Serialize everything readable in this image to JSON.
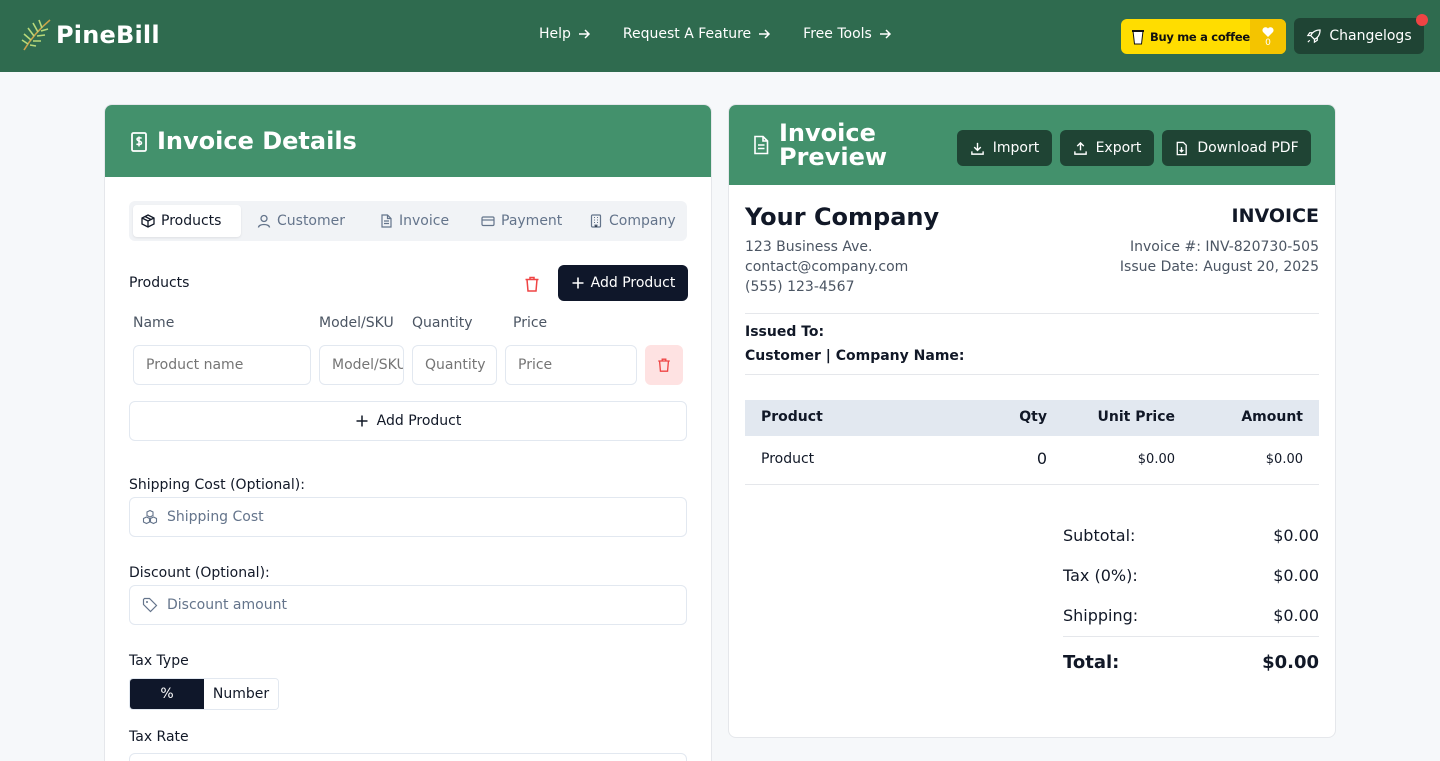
{
  "header": {
    "brand": "PineBill",
    "nav": [
      {
        "label": "Help",
        "icon": "arrow-right-icon"
      },
      {
        "label": "Request A Feature",
        "icon": "arrow-right-icon"
      },
      {
        "label": "Free Tools",
        "icon": "arrow-right-icon"
      }
    ],
    "coffee": {
      "label": "Buy me a coffee",
      "count": "0"
    },
    "changelog": "Changelogs",
    "colors": {
      "bar": "#2f6b4f",
      "accent": "#43916c",
      "dark_button": "#1f4434",
      "coffee": "#ffdd00"
    }
  },
  "details": {
    "title": "Invoice Details",
    "tabs": [
      {
        "label": "Products",
        "icon": "package-icon",
        "active": true
      },
      {
        "label": "Customer",
        "icon": "user-icon",
        "active": false
      },
      {
        "label": "Invoice",
        "icon": "file-text-icon",
        "active": false
      },
      {
        "label": "Payment",
        "icon": "credit-card-icon",
        "active": false
      },
      {
        "label": "Company",
        "icon": "building-icon",
        "active": false
      }
    ],
    "products_label": "Products",
    "add_product_label": "Add Product",
    "columns": [
      "Name",
      "Model/SKU",
      "Quantity",
      "Price"
    ],
    "row_placeholders": {
      "name": "Product name",
      "sku": "Model/SKU",
      "qty": "Quantity",
      "price": "Price"
    },
    "add_product_outline": "Add Product",
    "shipping_label": "Shipping Cost (Optional):",
    "shipping_placeholder": "Shipping Cost",
    "discount_label": "Discount (Optional):",
    "discount_placeholder": "Discount amount",
    "tax_type_label": "Tax Type",
    "tax_type_options": [
      "%",
      "Number"
    ],
    "tax_type_selected": "%",
    "tax_rate_label": "Tax Rate"
  },
  "preview": {
    "title": "Invoice Preview",
    "buttons": {
      "import": "Import",
      "export": "Export",
      "download": "Download PDF"
    },
    "company": {
      "name": "Your Company",
      "address": "123 Business Ave.",
      "email": "contact@company.com",
      "phone": "(555) 123-4567"
    },
    "invoice_heading": "INVOICE",
    "invoice_number": "Invoice #: INV-820730-505",
    "issue_date": "Issue Date: August 20, 2025",
    "issued_to": "Issued To:",
    "customer_line": "Customer | Company Name:",
    "table": {
      "headers": [
        "Product",
        "Qty",
        "Unit Price",
        "Amount"
      ],
      "rows": [
        {
          "product": "Product",
          "qty": "0",
          "unit": "$0.00",
          "amount": "$0.00"
        }
      ]
    },
    "totals": {
      "subtotal_label": "Subtotal:",
      "subtotal": "$0.00",
      "tax_label": "Tax (0%):",
      "tax": "$0.00",
      "shipping_label": "Shipping:",
      "shipping": "$0.00",
      "total_label": "Total:",
      "total": "$0.00"
    }
  }
}
